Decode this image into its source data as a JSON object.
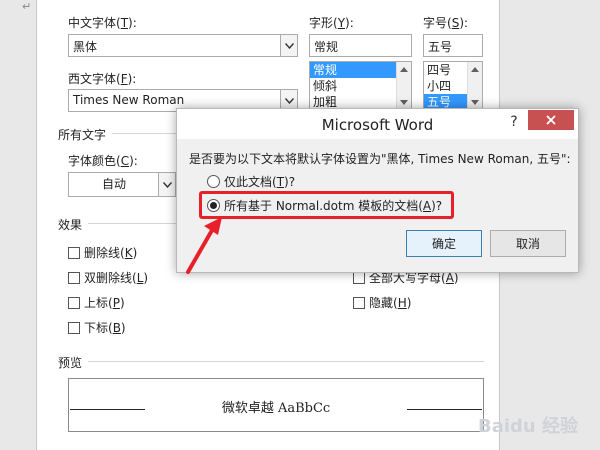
{
  "chinese_font": {
    "label": "中文字体(",
    "key": "T",
    "suffix": "):",
    "value": "黑体"
  },
  "style": {
    "label": "字形(",
    "key": "Y",
    "suffix": "):",
    "value": "常规",
    "options": [
      "常规",
      "倾斜",
      "加粗"
    ],
    "selected_index": 0
  },
  "size": {
    "label": "字号(",
    "key": "S",
    "suffix": "):",
    "value": "五号",
    "options": [
      "四号",
      "小四",
      "五号"
    ],
    "selected_index": 2
  },
  "western_font": {
    "label": "西文字体(",
    "key": "F",
    "suffix": "):",
    "value": "Times New Roman"
  },
  "all_text": {
    "title": "所有文字",
    "font_color_label": "字体颜色(",
    "font_color_key": "C",
    "font_color_suffix": "):",
    "font_color_value": "自动"
  },
  "effects": {
    "title": "效果",
    "left": [
      {
        "label": "删除线(",
        "key": "K",
        "suffix": ")"
      },
      {
        "label": "双删除线(",
        "key": "L",
        "suffix": ")"
      },
      {
        "label": "上标(",
        "key": "P",
        "suffix": ")"
      },
      {
        "label": "下标(",
        "key": "B",
        "suffix": ")"
      }
    ],
    "right": [
      {
        "label": "全部大写字母(",
        "key": "A",
        "suffix": ")"
      },
      {
        "label": "隐藏(",
        "key": "H",
        "suffix": ")"
      }
    ]
  },
  "preview": {
    "title": "预览",
    "text": "微软卓越  AaBbCc"
  },
  "modal": {
    "title": "Microsoft Word",
    "help": "?",
    "question": "是否要为以下文本将默认字体设置为\"黑体, Times New Roman, 五号\":",
    "option1": {
      "label": "仅此文档(",
      "key": "T",
      "suffix": ")?"
    },
    "option2": {
      "label": "所有基于 Normal.dotm 模板的文档(",
      "key": "A",
      "suffix": ")?"
    },
    "selected_option": 2,
    "ok_label": "确定",
    "cancel_label": "取消"
  },
  "margin_mark": "↵",
  "watermark": "Baidu 经验",
  "colors": {
    "highlight_red": "#e8202a",
    "selection_blue": "#3399ff",
    "close_red": "#c75050"
  }
}
